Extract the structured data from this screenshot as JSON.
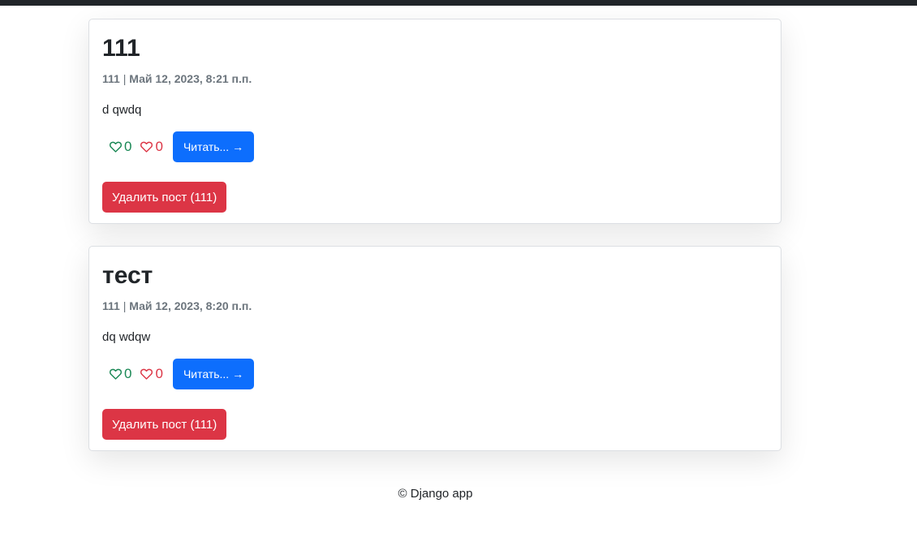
{
  "posts": [
    {
      "title": "111",
      "author": "111",
      "separator": "|",
      "date": "Май 12, 2023, 8:21 п.п.",
      "body": "d qwdq",
      "likes": "0",
      "dislikes": "0",
      "read_label": "Читать... →",
      "delete_label": "Удалить пост (111)"
    },
    {
      "title": "тест",
      "author": "111",
      "separator": "|",
      "date": "Май 12, 2023, 8:20 п.п.",
      "body": "dq wdqw",
      "likes": "0",
      "dislikes": "0",
      "read_label": "Читать... →",
      "delete_label": "Удалить пост (111)"
    }
  ],
  "footer": {
    "text": "© Django app"
  },
  "icons": {
    "like": "heart-outline-icon",
    "dislike": "heart-outline-icon"
  },
  "colors": {
    "topbar": "#212529",
    "like": "#198754",
    "dislike": "#dc3545",
    "primary": "#0d6efd",
    "danger": "#dc3545",
    "muted": "#6c757d"
  }
}
